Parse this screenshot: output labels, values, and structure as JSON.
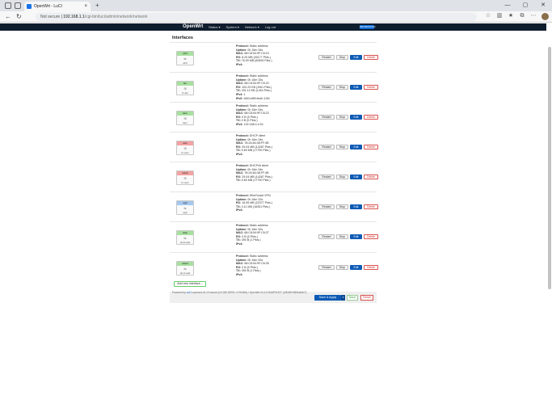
{
  "browser": {
    "tab_title": "OpenWrt - LuCI",
    "address": {
      "warning": "Not secure",
      "host": "192.168.1.1",
      "path": "/cgi-bin/luci/admin/network/network"
    }
  },
  "header": {
    "brand": "OpenWrt",
    "nav": [
      "Status ▾",
      "System ▾",
      "Network ▾",
      "Log out"
    ],
    "badge": "REFRESHING"
  },
  "page": {
    "title": "Interfaces"
  },
  "interfaces": [
    {
      "name": "wlr0",
      "color": "#a8e0a0",
      "dev": "wlr0",
      "icon": "⇆",
      "info": [
        [
          "Protocol:",
          "Static address"
        ],
        [
          "Uptime:",
          "0h 16m 34s"
        ],
        [
          "MAC:",
          "68:C8:54:9F:C6:24"
        ],
        [
          "RX:",
          "8.25 MB (30177 Pkts.)"
        ],
        [
          "TX:",
          "76.09 MB (60826 Pkts.)"
        ],
        [
          "IPv4:",
          ""
        ]
      ]
    },
    {
      "name": "lan",
      "color": "#a8e0a0",
      "dev": "br-lan",
      "icon": "⊞",
      "info": [
        [
          "Protocol:",
          "Static address"
        ],
        [
          "Uptime:",
          "0h 16m 33s"
        ],
        [
          "MAC:",
          "68:C8:54:9F:C6:22"
        ],
        [
          "RX:",
          "102.23 KB (1061 Pkts.)"
        ],
        [
          "TX:",
          "331.10 KB (1494 Pkts.)"
        ],
        [
          "IPv4:",
          "1"
        ],
        [
          "IPv6:",
          "fd00:ef89:fea5::1/60"
        ]
      ]
    },
    {
      "name": "lan1",
      "color": "#a8e0a0",
      "dev": "lan1",
      "icon": "⊞",
      "info": [
        [
          "Protocol:",
          "Static address"
        ],
        [
          "Uptime:",
          "0h 16m 34s"
        ],
        [
          "MAC:",
          "68:C8:54:9F:C6:22"
        ],
        [
          "RX:",
          "0 B (0 Pkts.)"
        ],
        [
          "TX:",
          "0 B (0 Pkts.)"
        ],
        [
          "IPv4:",
          "192.168.4.1/24"
        ]
      ]
    },
    {
      "name": "wan",
      "color": "#f3a3a3",
      "dev": "br-wan",
      "icon": "⊞",
      "info": [
        [
          "Protocol:",
          "DHCP client"
        ],
        [
          "Uptime:",
          "0h 16m 34s"
        ],
        [
          "MAC:",
          "78:2A:84:38:FF:4B"
        ],
        [
          "RX:",
          "29.04 MB (14287 Pkts.)"
        ],
        [
          "TX:",
          "5.69 MB (17790 Pkts.)"
        ],
        [
          "IPv4:",
          ""
        ]
      ]
    },
    {
      "name": "wan6",
      "color": "#f3a3a3",
      "dev": "br-wan",
      "icon": "⊞",
      "info": [
        [
          "Protocol:",
          "DHCPv6 client"
        ],
        [
          "Uptime:",
          "0h 16m 34s"
        ],
        [
          "MAC:",
          "78:2A:84:38:FF:4B"
        ],
        [
          "RX:",
          "29.04 MB (14287 Pkts.)"
        ],
        [
          "TX:",
          "5.69 MB (17790 Pkts.)"
        ]
      ]
    },
    {
      "name": "wg0",
      "color": "#a6c8f0",
      "dev": "wg0",
      "icon": "⇆",
      "info": [
        [
          "Protocol:",
          "WireGuard VPN"
        ],
        [
          "Uptime:",
          "0h 16m 32s"
        ],
        [
          "RX:",
          "16.95 MB (22377 Pkts.)"
        ],
        [
          "TX:",
          "4.11 MB (16351 Pkts.)"
        ],
        [
          "IPv4:",
          ""
        ]
      ]
    },
    {
      "name": "wlan",
      "color": "#a8e0a0",
      "dev": "phy0-ap0",
      "icon": "⇆",
      "info": [
        [
          "Protocol:",
          "Static address"
        ],
        [
          "Uptime:",
          "0h 16m 32s"
        ],
        [
          "MAC:",
          "68:C8:54:9F:C6:27"
        ],
        [
          "RX:",
          "0 B (0 Pkts.)"
        ],
        [
          "TX:",
          "390 B (1 Pkts.)"
        ],
        [
          "IPv4:",
          ""
        ]
      ]
    },
    {
      "name": "wlan2",
      "color": "#a8e0a0",
      "dev": "phy1-ap0",
      "icon": "⇆",
      "info": [
        [
          "Protocol:",
          "Static address"
        ],
        [
          "Uptime:",
          "0h 16m 32s"
        ],
        [
          "MAC:",
          "68:C8:54:9F:C6:26"
        ],
        [
          "RX:",
          "0 B (0 Pkts.)"
        ],
        [
          "TX:",
          "390 B (1 Pkts.)"
        ],
        [
          "IPv4:",
          ""
        ]
      ]
    }
  ],
  "buttons": {
    "restart": "Restart",
    "stop": "Stop",
    "edit": "Edit",
    "delete": "Delete",
    "add_interface": "Add new interface...",
    "save_apply": "Save & Apply",
    "save": "Save",
    "reset": "Reset"
  },
  "footer": {
    "prefix": "Powered by ",
    "link": "LuCI",
    "rest": " openwrt-24.10 branch (24.330.58791~e79169d) / OpenWrt 24.10-SNAPSHOT (r28185+689bdd3c7)"
  }
}
